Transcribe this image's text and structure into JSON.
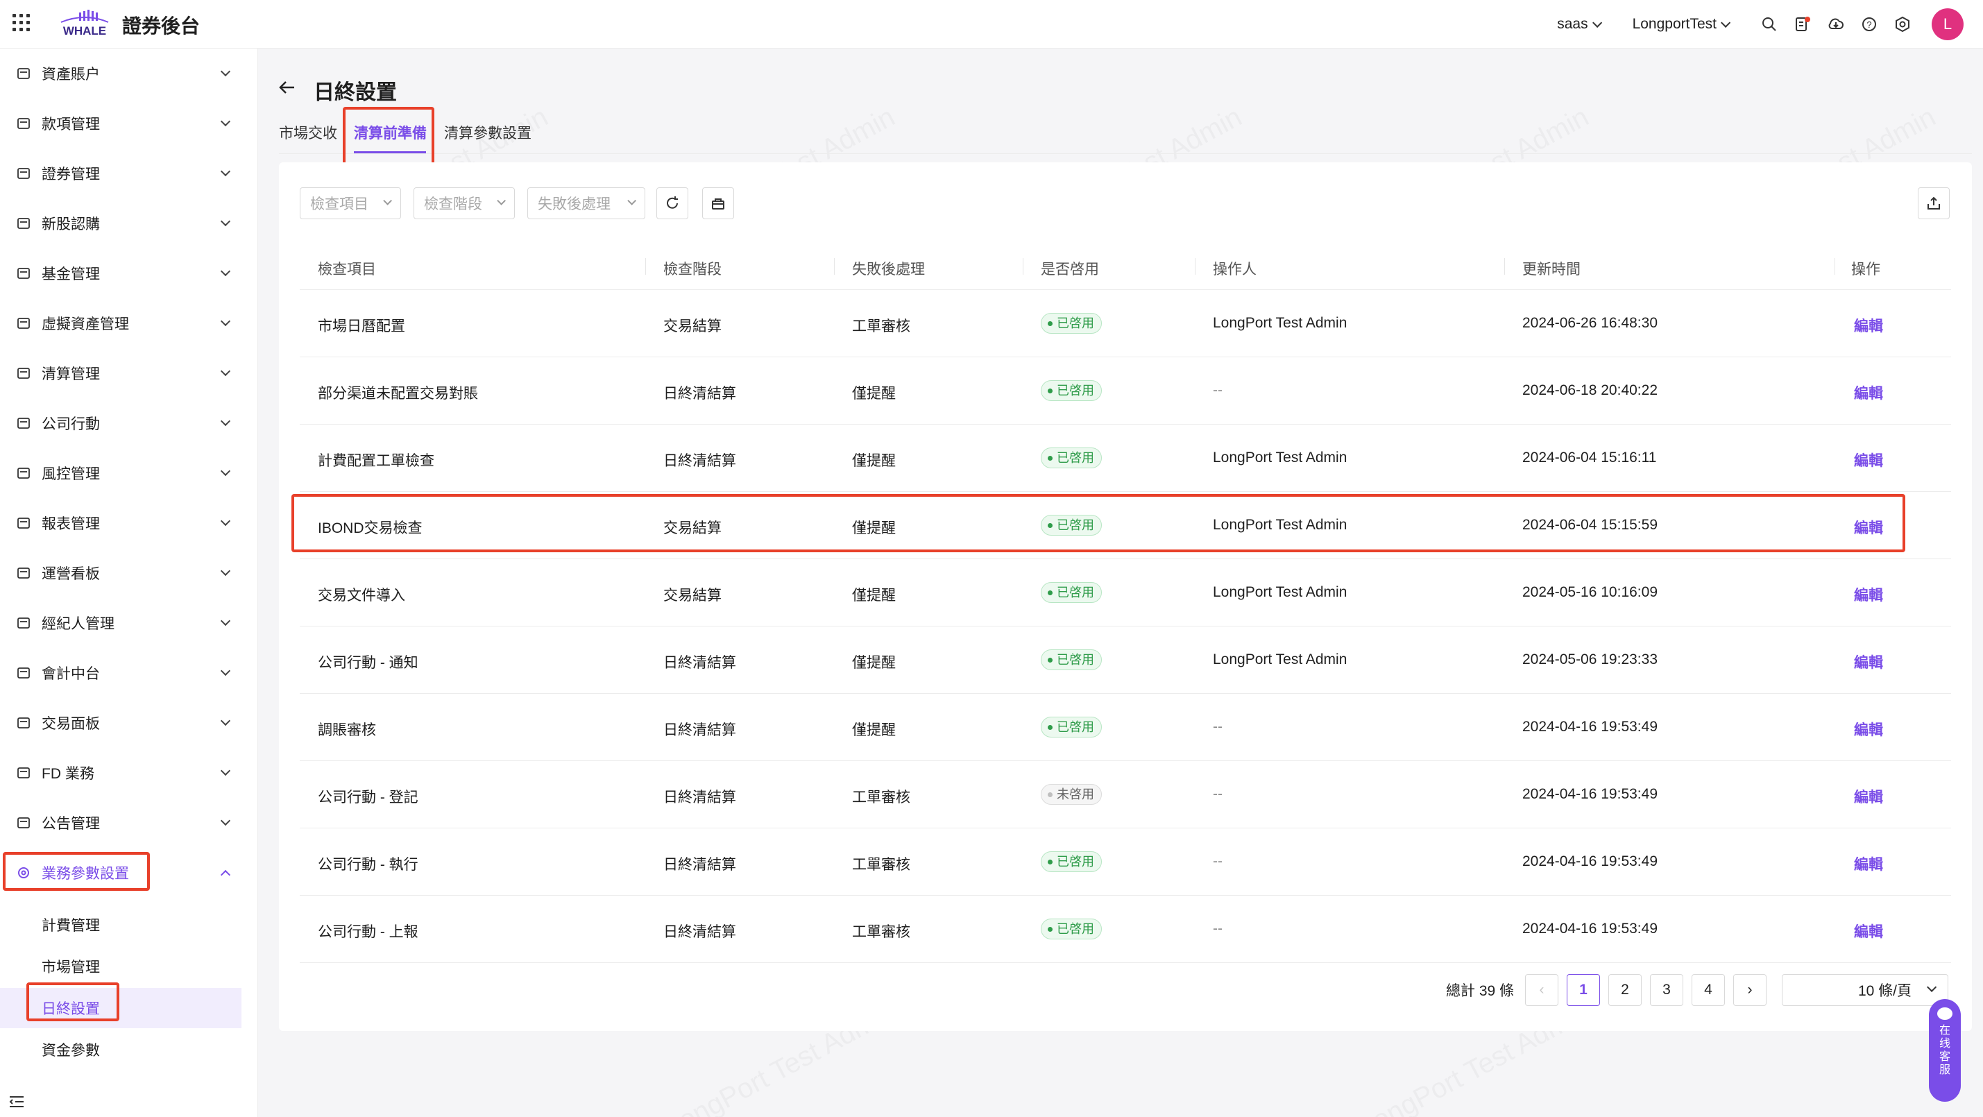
{
  "app": {
    "brand_title": "證券後台",
    "logo_text": "WHALE"
  },
  "topbar": {
    "tenant": "saas",
    "account": "LongportTest",
    "avatar_initial": "L"
  },
  "sidebar": {
    "items": [
      {
        "label": "資產賬户"
      },
      {
        "label": "款項管理"
      },
      {
        "label": "證券管理"
      },
      {
        "label": "新股認購"
      },
      {
        "label": "基金管理"
      },
      {
        "label": "虛擬資產管理"
      },
      {
        "label": "清算管理"
      },
      {
        "label": "公司行動"
      },
      {
        "label": "風控管理"
      },
      {
        "label": "報表管理"
      },
      {
        "label": "運營看板"
      },
      {
        "label": "經紀人管理"
      },
      {
        "label": "會計中台"
      },
      {
        "label": "交易面板"
      },
      {
        "label": "FD 業務"
      },
      {
        "label": "公告管理"
      },
      {
        "label": "業務參數設置"
      }
    ],
    "sub_items": [
      {
        "label": "計費管理"
      },
      {
        "label": "市場管理"
      },
      {
        "label": "日終設置"
      },
      {
        "label": "資金參數"
      }
    ]
  },
  "page": {
    "title": "日終設置",
    "tabs": [
      {
        "label": "市場交收"
      },
      {
        "label": "清算前準備"
      },
      {
        "label": "清算參數設置"
      }
    ]
  },
  "filters": {
    "check_item": "檢查項目",
    "check_stage": "檢查階段",
    "failure_handling": "失敗後處理"
  },
  "table": {
    "columns": [
      "檢查項目",
      "檢查階段",
      "失敗後處理",
      "是否啓用",
      "操作人",
      "更新時間",
      "操作"
    ],
    "rows": [
      {
        "item": "市場日曆配置",
        "stage": "交易結算",
        "failure": "工單審核",
        "status": "已啓用",
        "operator": "LongPort Test Admin",
        "updated": "2024-06-26 16:48:30",
        "action": "編輯"
      },
      {
        "item": "部分渠道未配置交易對賬",
        "stage": "日終清結算",
        "failure": "僅提醒",
        "status": "已啓用",
        "operator": "--",
        "updated": "2024-06-18 20:40:22",
        "action": "編輯"
      },
      {
        "item": "計費配置工單檢查",
        "stage": "日終清結算",
        "failure": "僅提醒",
        "status": "已啓用",
        "operator": "LongPort Test Admin",
        "updated": "2024-06-04 15:16:11",
        "action": "編輯"
      },
      {
        "item": "IBOND交易檢查",
        "stage": "交易結算",
        "failure": "僅提醒",
        "status": "已啓用",
        "operator": "LongPort Test Admin",
        "updated": "2024-06-04 15:15:59",
        "action": "編輯"
      },
      {
        "item": "交易文件導入",
        "stage": "交易結算",
        "failure": "僅提醒",
        "status": "已啓用",
        "operator": "LongPort Test Admin",
        "updated": "2024-05-16 10:16:09",
        "action": "編輯"
      },
      {
        "item": "公司行動 - 通知",
        "stage": "日終清結算",
        "failure": "僅提醒",
        "status": "已啓用",
        "operator": "LongPort Test Admin",
        "updated": "2024-05-06 19:23:33",
        "action": "編輯"
      },
      {
        "item": "調賬審核",
        "stage": "日終清結算",
        "failure": "僅提醒",
        "status": "已啓用",
        "operator": "--",
        "updated": "2024-04-16 19:53:49",
        "action": "編輯"
      },
      {
        "item": "公司行動 - 登記",
        "stage": "日終清結算",
        "failure": "工單審核",
        "status": "未啓用",
        "operator": "--",
        "updated": "2024-04-16 19:53:49",
        "action": "編輯"
      },
      {
        "item": "公司行動 - 執行",
        "stage": "日終清結算",
        "failure": "工單審核",
        "status": "已啓用",
        "operator": "--",
        "updated": "2024-04-16 19:53:49",
        "action": "編輯"
      },
      {
        "item": "公司行動 - 上報",
        "stage": "日終清結算",
        "failure": "工單審核",
        "status": "已啓用",
        "operator": "--",
        "updated": "2024-04-16 19:53:49",
        "action": "編輯"
      }
    ]
  },
  "pagination": {
    "total": "總計 39 條",
    "pages": [
      "1",
      "2",
      "3",
      "4"
    ],
    "current": "1",
    "page_size": "10 條/頁"
  },
  "support_widget": {
    "label": [
      "在",
      "线",
      "客",
      "服"
    ]
  },
  "watermark": "LongPort Test Admin",
  "colors": {
    "accent": "#7a4de8",
    "highlight": "#e8402a",
    "enabled_green": "#2f9c4a",
    "avatar": "#e0317f"
  }
}
